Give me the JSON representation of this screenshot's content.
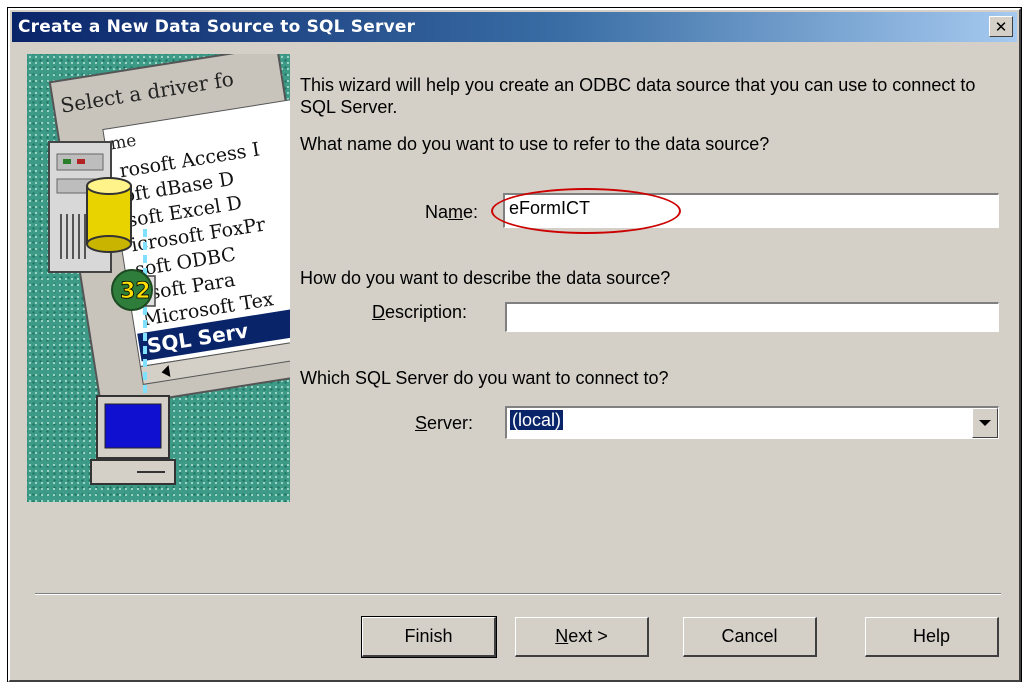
{
  "window": {
    "title": "Create a New Data Source to SQL Server",
    "close_glyph": "✕"
  },
  "illustration": {
    "dialog_caption": "Select a driver fo",
    "column_header": "me",
    "driver_list": [
      "rosoft Access I",
      "oft dBase D",
      "soft Excel D",
      "icrosoft FoxPr",
      "soft ODBC",
      "osoft Para",
      "Microsoft Tex",
      "SQL Serv"
    ],
    "badge": "32",
    "icons": [
      "server-tower-icon",
      "database-cylinder-icon",
      "globe-network-icon",
      "desktop-computer-icon"
    ]
  },
  "intro": "This wizard will help you create an ODBC data source that you can use to connect to SQL Server.",
  "questions": {
    "name": "What name do you want to use to refer to the data source?",
    "description": "How do you want to describe the data source?",
    "server": "Which SQL Server do you want to connect to?"
  },
  "fields": {
    "name": {
      "label_pre": "Na",
      "label_ul": "m",
      "label_post": "e:",
      "value": "eFormICT"
    },
    "description": {
      "label_pre": "",
      "label_ul": "D",
      "label_post": "escription:",
      "value": ""
    },
    "server": {
      "label_pre": "",
      "label_ul": "S",
      "label_post": "erver:",
      "value": "(local)"
    }
  },
  "buttons": {
    "finish": {
      "pre": "Finish",
      "ul": "",
      "post": ""
    },
    "next": {
      "pre": "",
      "ul": "N",
      "post": "ext >"
    },
    "cancel": {
      "pre": "Cancel",
      "ul": "",
      "post": ""
    },
    "help": {
      "pre": "Help",
      "ul": "",
      "post": ""
    }
  },
  "colors": {
    "title_bar_start": "#0a246a",
    "title_bar_end": "#a6caf0",
    "dialog_face": "#d4d0c8",
    "highlight_oval": "#cc0000",
    "selection": "#0a246a"
  }
}
